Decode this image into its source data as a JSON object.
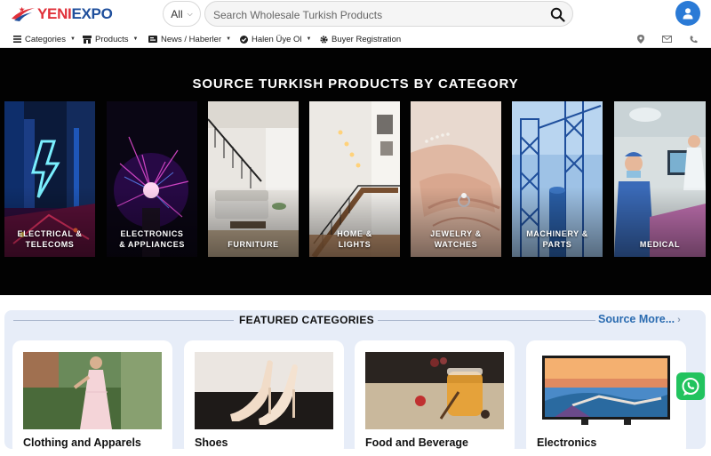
{
  "brand": {
    "logo_yeni": "YENI",
    "logo_expo": "EXPO",
    "red": "#e0313a",
    "blue": "#1f4f9c"
  },
  "search": {
    "scope": "All",
    "placeholder": "Search Wholesale Turkish Products"
  },
  "nav": {
    "categories": "Categories",
    "products": "Products",
    "news": "News / Haberler",
    "member": "Halen Üye Ol",
    "buyer": "Buyer Registration"
  },
  "hero": {
    "title": "SOURCE TURKISH PRODUCTS BY CATEGORY",
    "categories": [
      {
        "line1": "ELECTRICAL &",
        "line2": "TELECOMS"
      },
      {
        "line1": "ELECTRONICS",
        "line2": "& APPLIANCES"
      },
      {
        "line1": "",
        "line2": "FURNITURE"
      },
      {
        "line1": "HOME &",
        "line2": "LIGHTS"
      },
      {
        "line1": "JEWELRY &",
        "line2": "WATCHES"
      },
      {
        "line1": "MACHINERY &",
        "line2": "PARTS"
      },
      {
        "line1": "",
        "line2": "MEDICAL"
      }
    ]
  },
  "featured": {
    "title": "FEATURED CATEGORIES",
    "source_more": "Source More...",
    "items": [
      {
        "name": "Clothing and Apparels"
      },
      {
        "name": "Shoes"
      },
      {
        "name": "Food and Beverage"
      },
      {
        "name": "Electronics"
      }
    ]
  },
  "colors": {
    "accent_blue": "#2a6bb0",
    "whatsapp_green": "#22c35e",
    "user_blue": "#2a7ad6",
    "featured_bg": "#e7edf8"
  }
}
